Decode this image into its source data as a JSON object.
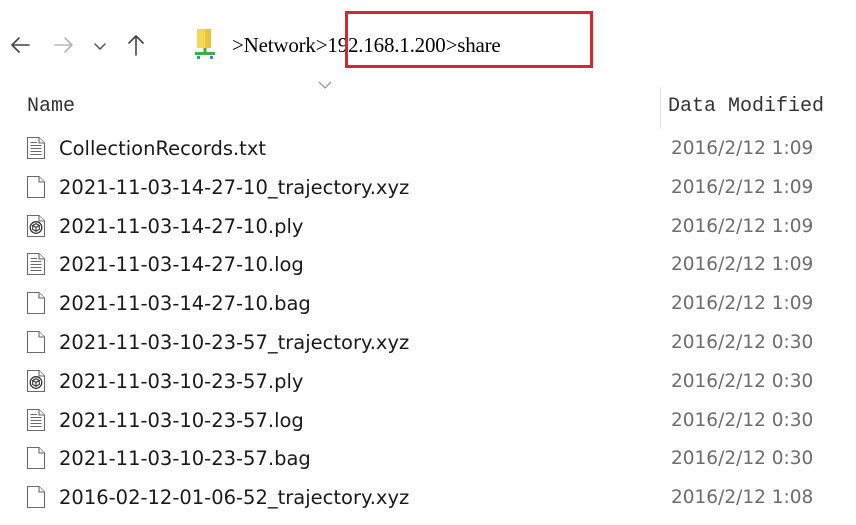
{
  "navigation": {
    "back_icon": "arrow-left-icon",
    "forward_icon": "arrow-right-icon",
    "recent_icon": "chevron-down-icon",
    "up_icon": "arrow-up-icon",
    "location_icon": "network-folder-icon"
  },
  "breadcrumb": {
    "items": [
      {
        "sep": ">",
        "label": "Network"
      },
      {
        "sep": ">",
        "label": "192.168.1.200"
      },
      {
        "sep": ">",
        "label": "share"
      }
    ],
    "highlight_color": "#d7262e"
  },
  "columns": {
    "name": "Name",
    "date": "Data Modified"
  },
  "files": [
    {
      "name": "CollectionRecords.txt",
      "date": "2016/2/12 1:09",
      "icon": "text-file-icon"
    },
    {
      "name": "2021-11-03-14-27-10_trajectory.xyz",
      "date": "2016/2/12 1:09",
      "icon": "blank-file-icon"
    },
    {
      "name": "2021-11-03-14-27-10.ply",
      "date": "2016/2/12 1:09",
      "icon": "3d-object-file-icon"
    },
    {
      "name": "2021-11-03-14-27-10.log",
      "date": "2016/2/12 1:09",
      "icon": "text-file-icon"
    },
    {
      "name": "2021-11-03-14-27-10.bag",
      "date": "2016/2/12 1:09",
      "icon": "blank-file-icon"
    },
    {
      "name": "2021-11-03-10-23-57_trajectory.xyz",
      "date": "2016/2/12 0:30",
      "icon": "blank-file-icon"
    },
    {
      "name": "2021-11-03-10-23-57.ply",
      "date": "2016/2/12 0:30",
      "icon": "3d-object-file-icon"
    },
    {
      "name": "2021-11-03-10-23-57.log",
      "date": "2016/2/12 0:30",
      "icon": "text-file-icon"
    },
    {
      "name": "2021-11-03-10-23-57.bag",
      "date": "2016/2/12 0:30",
      "icon": "blank-file-icon"
    },
    {
      "name": "2016-02-12-01-06-52_trajectory.xyz",
      "date": "2016/2/12 1:08",
      "icon": "blank-file-icon"
    }
  ]
}
